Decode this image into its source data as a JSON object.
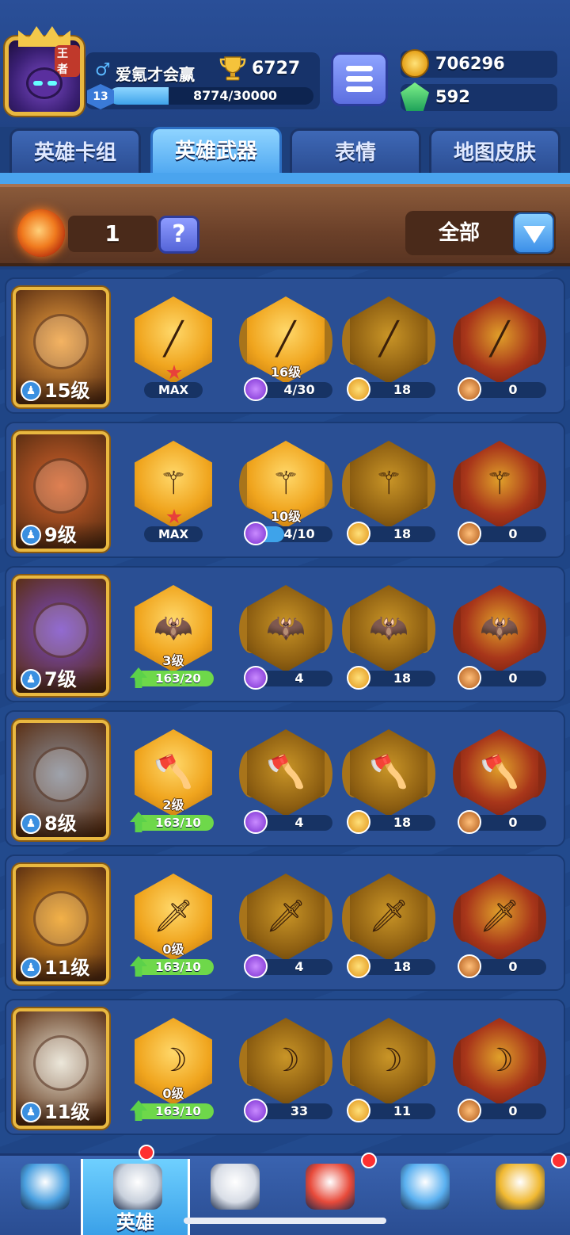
{
  "player": {
    "name": "爱氪才会赢",
    "trophies": "6727",
    "level": "13",
    "xp": "8774/30000",
    "xp_fraction": 0.29,
    "avatar_crown_text": "王者"
  },
  "currency": {
    "gold": "706296",
    "gems": "592"
  },
  "tabs": [
    {
      "label": "英雄卡组",
      "active": false
    },
    {
      "label": "英雄武器",
      "active": true
    },
    {
      "label": "表情",
      "active": false
    },
    {
      "label": "地图皮肤",
      "active": false
    }
  ],
  "filter": {
    "fragment_count": "1",
    "help_label": "?",
    "selected": "全部"
  },
  "heroes": [
    {
      "level": "15级",
      "color": "#f2a340",
      "slots": [
        {
          "style": "gold",
          "glyph": "╱",
          "label": "",
          "kind": "max",
          "value": "MAX"
        },
        {
          "style": "gold",
          "glyph": "╱",
          "label": "16级",
          "kind": "cost",
          "icon": "purple",
          "value": "4/30",
          "fill": 0.13
        },
        {
          "style": "dark",
          "glyph": "╱",
          "label": "",
          "kind": "cost",
          "icon": "gold",
          "value": "18"
        },
        {
          "style": "red",
          "glyph": "╱",
          "label": "",
          "kind": "cost",
          "icon": "hero",
          "value": "0"
        }
      ]
    },
    {
      "level": "9级",
      "color": "#d8642c",
      "slots": [
        {
          "style": "gold",
          "glyph": "⚚",
          "label": "",
          "kind": "max",
          "value": "MAX"
        },
        {
          "style": "gold",
          "glyph": "⚚",
          "label": "10级",
          "kind": "cost",
          "icon": "purple",
          "value": "4/10",
          "fill": 0.4
        },
        {
          "style": "dark",
          "glyph": "⚚",
          "label": "",
          "kind": "cost",
          "icon": "gold",
          "value": "18"
        },
        {
          "style": "red",
          "glyph": "⚚",
          "label": "",
          "kind": "cost",
          "icon": "hero",
          "value": "0"
        }
      ]
    },
    {
      "level": "7级",
      "color": "#7a4ac8",
      "slots": [
        {
          "style": "gold",
          "glyph": "🦇",
          "label": "3级",
          "kind": "upgrade",
          "value": "163/20"
        },
        {
          "style": "dark",
          "glyph": "🦇",
          "label": "",
          "kind": "cost",
          "icon": "purple",
          "value": "4"
        },
        {
          "style": "dark",
          "glyph": "🦇",
          "label": "",
          "kind": "cost",
          "icon": "gold",
          "value": "18"
        },
        {
          "style": "red",
          "glyph": "🦇",
          "label": "",
          "kind": "cost",
          "icon": "hero",
          "value": "0"
        }
      ]
    },
    {
      "level": "8级",
      "color": "#8a8f9a",
      "slots": [
        {
          "style": "gold",
          "glyph": "🪓",
          "label": "2级",
          "kind": "upgrade",
          "value": "163/10"
        },
        {
          "style": "dark",
          "glyph": "🪓",
          "label": "",
          "kind": "cost",
          "icon": "purple",
          "value": "4"
        },
        {
          "style": "dark",
          "glyph": "🪓",
          "label": "",
          "kind": "cost",
          "icon": "gold",
          "value": "18"
        },
        {
          "style": "red",
          "glyph": "🪓",
          "label": "",
          "kind": "cost",
          "icon": "hero",
          "value": "0"
        }
      ]
    },
    {
      "level": "11级",
      "color": "#f0a020",
      "slots": [
        {
          "style": "gold",
          "glyph": "🗡",
          "label": "0级",
          "kind": "upgrade",
          "value": "163/10"
        },
        {
          "style": "dark",
          "glyph": "🗡",
          "label": "",
          "kind": "cost",
          "icon": "purple",
          "value": "4"
        },
        {
          "style": "dark",
          "glyph": "🗡",
          "label": "",
          "kind": "cost",
          "icon": "gold",
          "value": "18"
        },
        {
          "style": "red",
          "glyph": "🗡",
          "label": "",
          "kind": "cost",
          "icon": "hero",
          "value": "0"
        }
      ]
    },
    {
      "level": "11级",
      "color": "#e8e2d2",
      "slots": [
        {
          "style": "gold",
          "glyph": "☽",
          "label": "0级",
          "kind": "upgrade",
          "value": "163/10"
        },
        {
          "style": "dark",
          "glyph": "☽",
          "label": "",
          "kind": "cost",
          "icon": "purple",
          "value": "33"
        },
        {
          "style": "dark",
          "glyph": "☽",
          "label": "",
          "kind": "cost",
          "icon": "gold",
          "value": "11"
        },
        {
          "style": "red",
          "glyph": "☽",
          "label": "",
          "kind": "cost",
          "icon": "hero",
          "value": "0"
        }
      ]
    }
  ],
  "bottom_nav": [
    {
      "label": "",
      "icon": "treasure-chest-icon",
      "color": "#4aa0e0",
      "active": false,
      "dot": false
    },
    {
      "label": "英雄",
      "icon": "knight-helmet-icon",
      "color": "#c8d0dc",
      "active": true,
      "dot": true
    },
    {
      "label": "",
      "icon": "crossed-swords-icon",
      "color": "#d8dde6",
      "active": false,
      "dot": false
    },
    {
      "label": "",
      "icon": "crown-shield-icon",
      "color": "#e84a3a",
      "active": false,
      "dot": true
    },
    {
      "label": "",
      "icon": "friends-banner-icon",
      "color": "#5ab0f0",
      "active": false,
      "dot": false
    },
    {
      "label": "",
      "icon": "compass-icon",
      "color": "#f0b830",
      "active": false,
      "dot": true
    }
  ]
}
